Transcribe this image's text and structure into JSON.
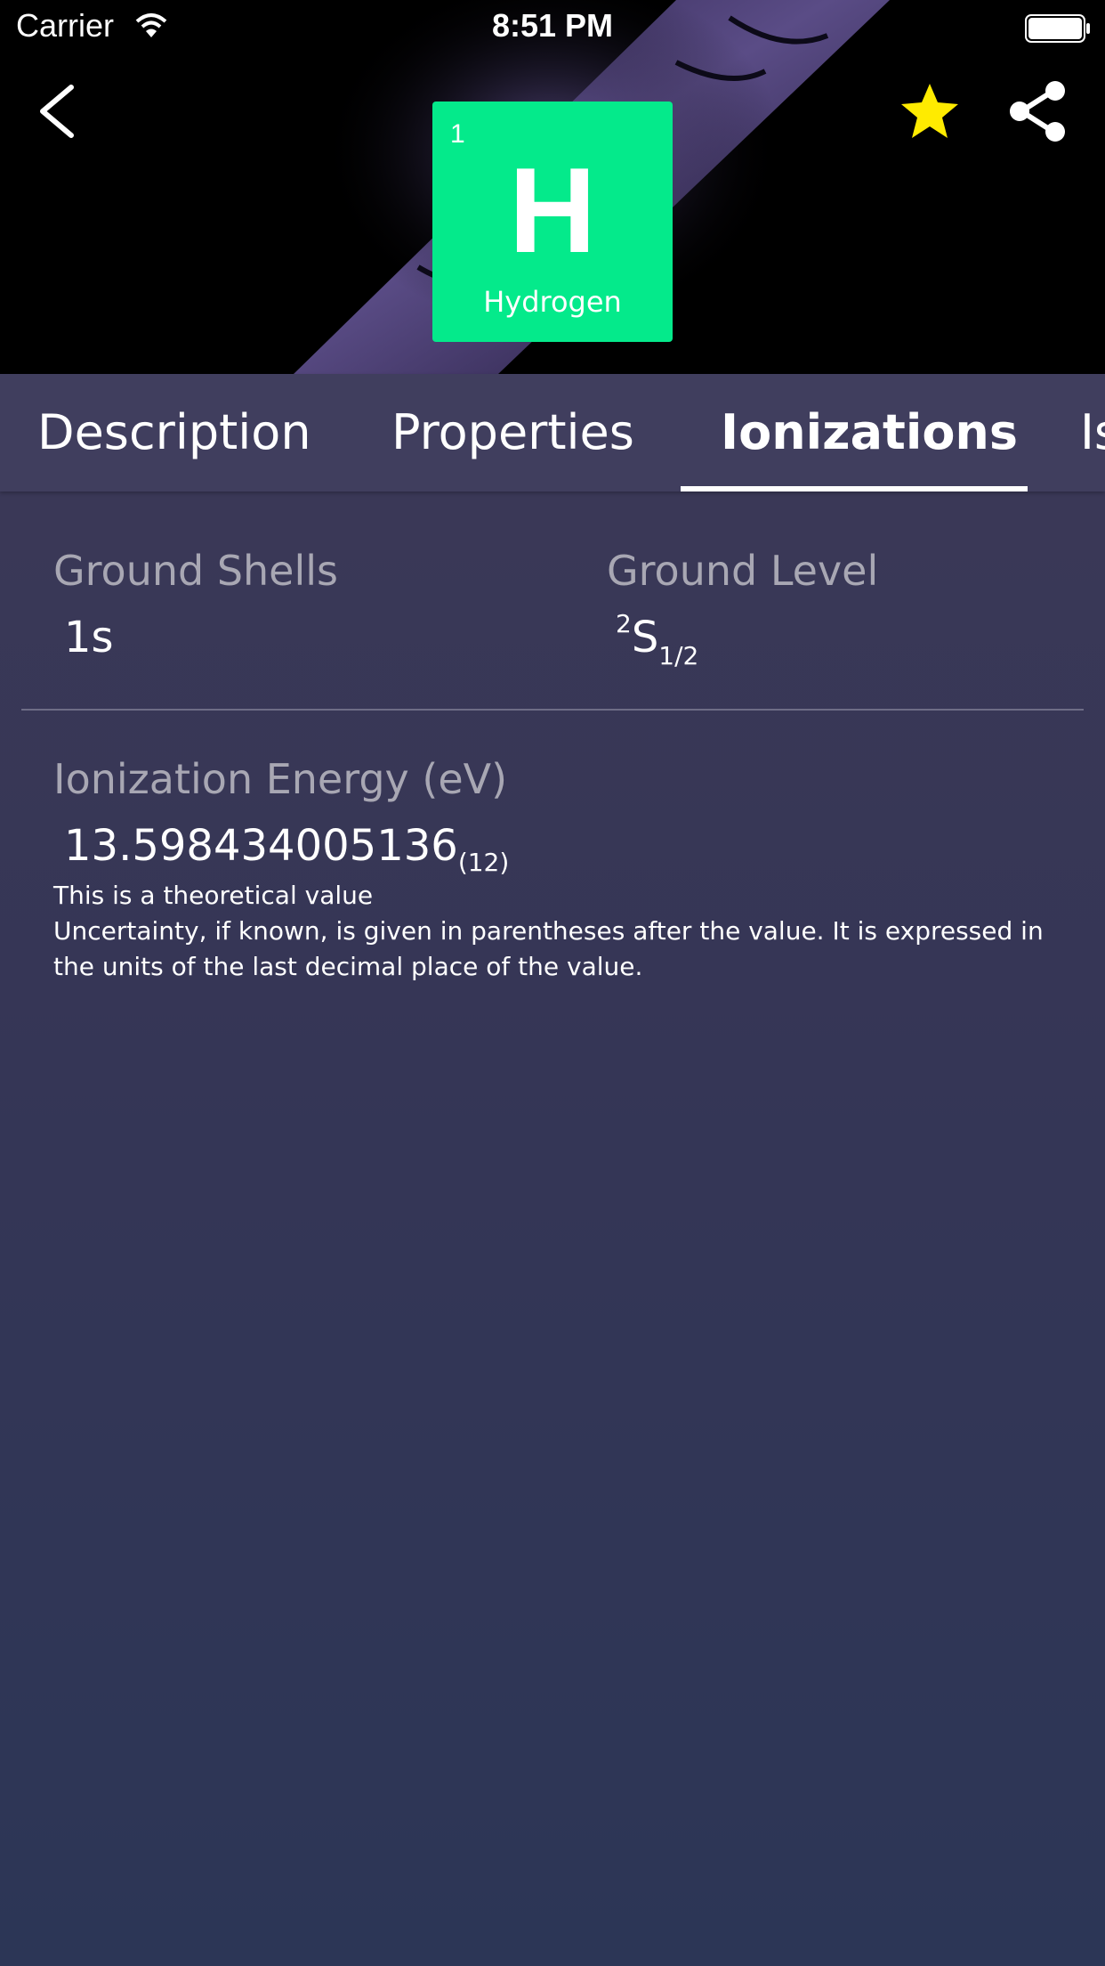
{
  "status_bar": {
    "carrier": "Carrier",
    "time": "8:51 PM"
  },
  "header": {
    "back_icon": "chevron-left-icon",
    "favorite_icon": "star-icon",
    "favorite_color": "#FFEB00",
    "share_icon": "share-icon"
  },
  "element": {
    "number": "1",
    "symbol": "H",
    "name": "Hydrogen",
    "tile_color": "#04EA8B"
  },
  "tabs": [
    {
      "label": "Description",
      "active": false
    },
    {
      "label": "Properties",
      "active": false
    },
    {
      "label": "Ionizations",
      "active": true
    },
    {
      "label": "Is",
      "active": false
    }
  ],
  "ground_shells": {
    "label": "Ground Shells",
    "value": "1s"
  },
  "ground_level": {
    "label": "Ground Level",
    "superscript": "2",
    "term": "S",
    "subscript": "1/2"
  },
  "ionization_energy": {
    "label": "Ionization Energy (eV)",
    "value": "13.598434005136",
    "uncertainty": "(12)",
    "note_1": "This is a theoretical value",
    "note_2": "Uncertainty, if known, is given in parentheses after the value. It is expressed in the units of the last decimal place of the value."
  }
}
